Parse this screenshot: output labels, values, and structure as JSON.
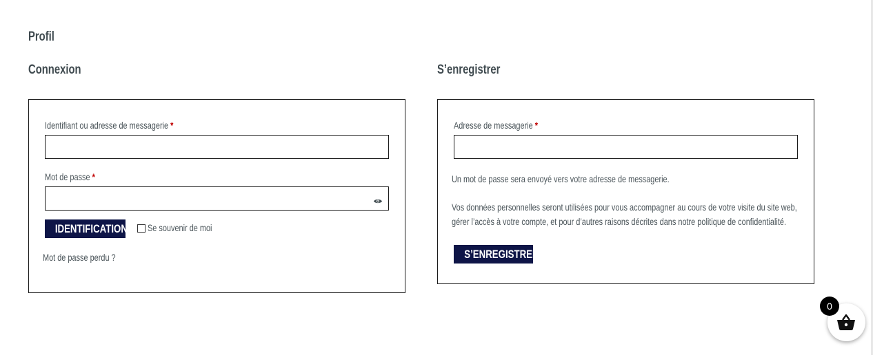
{
  "page": {
    "title": "Profil"
  },
  "login": {
    "heading": "Connexion",
    "username_label": "Identifiant ou adresse de messagerie",
    "username_value": "",
    "password_label": "Mot de passe",
    "password_value": "",
    "required_mark": "*",
    "submit_label": "IDENTIFICATION",
    "remember_label": "Se souvenir de moi",
    "remember_checked": false,
    "lost_password_link": "Mot de passe perdu ?"
  },
  "register": {
    "heading": "S’enregistrer",
    "email_label": "Adresse de messagerie",
    "email_value": "",
    "required_mark": "*",
    "password_notice": "Un mot de passe sera envoyé vers votre adresse de messagerie.",
    "privacy_text": "Vos données personnelles seront utilisées pour vous accompagner au cours de votre visite du site web, gérer l’accès à votre compte, et pour d’autres raisons décrites dans notre politique de confidentialité.",
    "submit_label": "S’ENREGISTRER"
  },
  "cart": {
    "count": "0",
    "icon": "basket-icon"
  },
  "colors": {
    "button_bg": "#0e1547",
    "required": "#c00000",
    "text": "#4a5459"
  }
}
